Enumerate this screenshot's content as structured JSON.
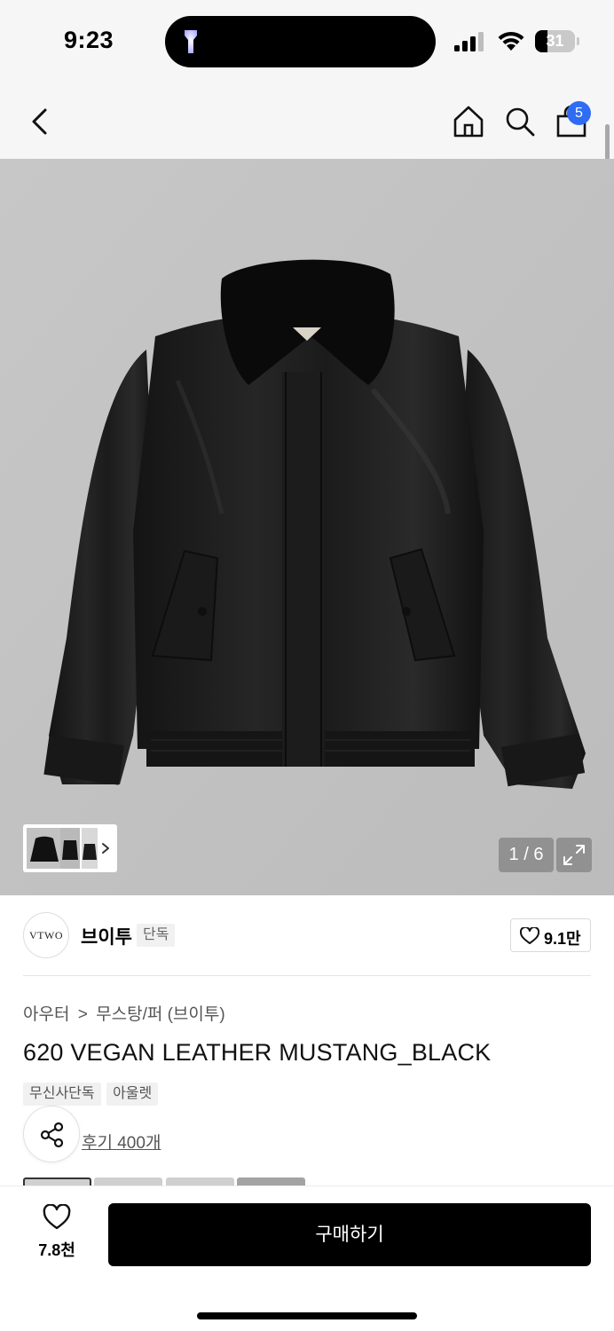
{
  "status_bar": {
    "time": "9:23",
    "battery": "31",
    "battery_level": 0.31
  },
  "header": {
    "cart_count": "5"
  },
  "gallery": {
    "counter": "1 / 6"
  },
  "brand": {
    "logo_text": "VTWO",
    "name": "브이투",
    "tag": "단독",
    "likes": "9.1만"
  },
  "product": {
    "breadcrumb": [
      "아우터",
      "무스탕/퍼 (브이투)"
    ],
    "breadcrumb_separator": ">",
    "title": "620 VEGAN LEATHER MUSTANG_BLACK",
    "tags": [
      "무신사단독",
      "아울렛"
    ],
    "reviews": "후기 400개"
  },
  "bottom_bar": {
    "wish_count": "7.8천",
    "buy_label": "구매하기"
  },
  "colors": {
    "accent_badge": "#2f6cf4",
    "buy_button": "#000000"
  }
}
